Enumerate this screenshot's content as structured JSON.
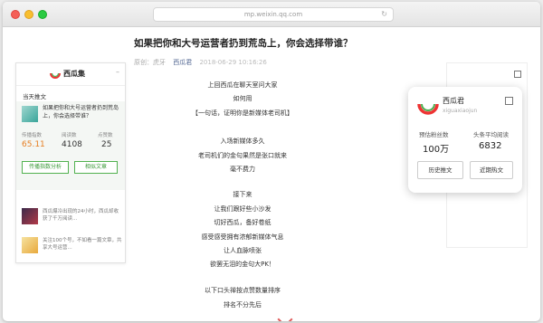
{
  "browser": {
    "url": "mp.weixin.qq.com"
  },
  "article": {
    "title": "如果把你和大号运营者扔到荒岛上，你会选择带谁？",
    "meta_author": "原创：虎牙",
    "meta_account": "西瓜君",
    "meta_date": "2018-06-29 10:16:26",
    "lines": [
      "上回西瓜在聊天室问大家",
      "如何用",
      "【一句话，证明你是新媒体老司机】",
      "入场新媒体多久",
      "老司机们的金句果然是张口就来",
      "毫不费力",
      "接下来",
      "让我们跟好些小沙发",
      "切好西瓜，备好卷纸",
      "感受感受拥有浓郁新媒体气息",
      "让人血脉喷张",
      "欲罢无泪的金句大PK！",
      "以下口头禅按点赞数量排序",
      "排名不分先后"
    ]
  },
  "left_panel": {
    "brand": "西瓜集",
    "section": "当天推文",
    "highlight_title": "如果把你和大号运营者扔到荒岛上，你会选择带谁？",
    "stats": [
      {
        "label": "传播指数",
        "value": "65.11"
      },
      {
        "label": "阅读数",
        "value": "4108"
      },
      {
        "label": "点赞数",
        "value": "25"
      }
    ],
    "btn_analysis": "传播指数分析",
    "btn_similar": "相似文章",
    "items": [
      {
        "text": "西瓜爆冷出现的24小时，西瓜却收获了千万阅读..."
      },
      {
        "text": "关注100个号，不如看一篇文章，共享大号运营..."
      }
    ]
  },
  "right_card": {
    "name": "西瓜君",
    "subtitle": "xiguaxiaojun",
    "label1": "预估粉丝数",
    "value1": "100万",
    "label2": "头条平均阅读",
    "value2": "6832",
    "btn_history": "历史推文",
    "btn_hot": "近期热文"
  },
  "colors": {
    "accent": "#51b14f",
    "highlight_value": "#e67e22",
    "chevron": "#e05a5a"
  }
}
